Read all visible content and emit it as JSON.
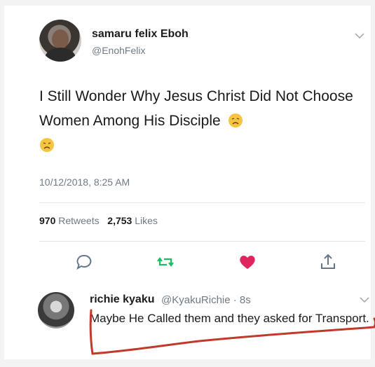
{
  "tweet": {
    "display_name": "samaru felix Eboh",
    "handle": "@EnohFelix",
    "text": "I Still Wonder Why Jesus Christ Did Not Choose Women Among His Disciple",
    "timestamp": "10/12/2018, 8:25 AM",
    "retweets_count": "970",
    "retweets_label": "Retweets",
    "likes_count": "2,753",
    "likes_label": "Likes"
  },
  "actions": {
    "icons": [
      "reply-icon",
      "retweet-icon",
      "like-icon",
      "share-icon"
    ],
    "colors": {
      "retweet": "#17bf63",
      "like": "#e0245e",
      "neutral": "#657786"
    }
  },
  "reply": {
    "display_name": "richie kyaku",
    "handle": "@KyakuRichie · 8s",
    "text": "Maybe He Called them and they asked for Transport."
  },
  "annotation": {
    "color": "#c0392b"
  }
}
